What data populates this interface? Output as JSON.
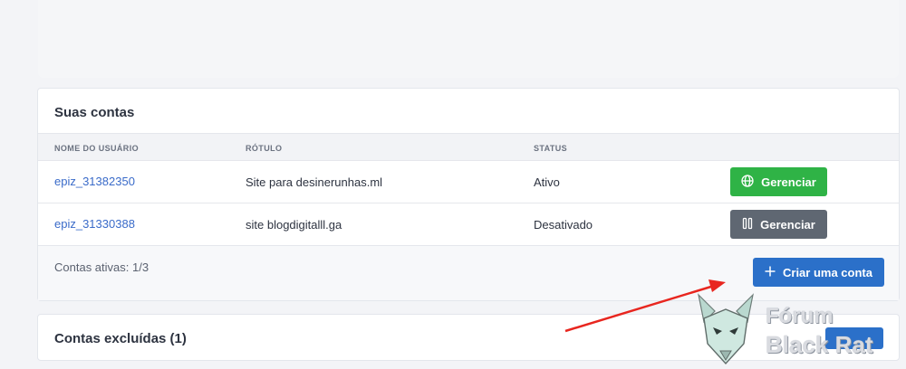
{
  "accounts": {
    "title": "Suas contas",
    "columns": [
      "NOME DO USUÁRIO",
      "RÓTULO",
      "STATUS"
    ],
    "rows": [
      {
        "username": "epiz_31382350",
        "label": "Site para desinerunhas.ml",
        "status": "Ativo",
        "button": "Gerenciar",
        "button_color": "#2fb346",
        "icon": "globe-icon"
      },
      {
        "username": "epiz_31330388",
        "label": "site blogdigitalll.ga",
        "status": "Desativado",
        "button": "Gerenciar",
        "button_color": "#5f6772",
        "icon": "pause-icon"
      }
    ],
    "active_count": "Contas ativas: 1/3",
    "create_button": "Criar uma conta"
  },
  "deleted": {
    "title": "Contas excluídas (1)"
  },
  "watermark": {
    "line1": "Fórum",
    "line2": "Black Rat"
  },
  "colors": {
    "accent_blue": "#2b70c9",
    "success_green": "#2fb346",
    "disabled_gray": "#5f6772",
    "annotation_arrow": "#e8261f"
  }
}
